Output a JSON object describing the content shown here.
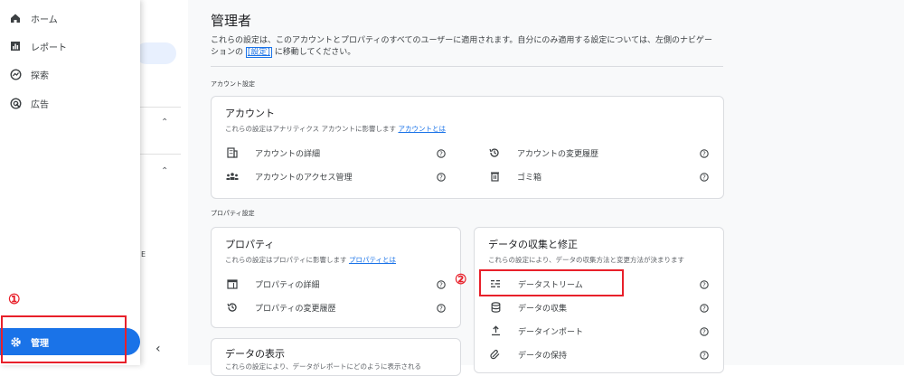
{
  "nav": {
    "items": [
      {
        "label": "ホーム",
        "icon": "home-icon"
      },
      {
        "label": "レポート",
        "icon": "reports-icon"
      },
      {
        "label": "探索",
        "icon": "explore-icon"
      },
      {
        "label": "広告",
        "icon": "advertising-icon"
      }
    ],
    "admin_label": "管理"
  },
  "page": {
    "title": "管理者",
    "desc_line1": "これらの設定は、このアカウントとプロパティのすべてのユーザーに適用されます。自分にのみ適用する設定については、左側のナビゲー",
    "desc_line2_pre": "ションの",
    "desc_link": "[設定]",
    "desc_line2_post": "に移動してください。",
    "account_section": "アカウント設定",
    "property_section": "プロパティ設定"
  },
  "account_card": {
    "title": "アカウント",
    "sub": "これらの設定はアナリティクス アカウントに影響します",
    "sub_link": "アカウントとは",
    "rows": [
      "アカウントの詳細",
      "アカウントのアクセス管理",
      "アカウントの変更履歴",
      "ゴミ箱"
    ]
  },
  "property_card": {
    "title": "プロパティ",
    "sub": "これらの設定はプロパティに影響します",
    "sub_link": "プロパティとは",
    "rows": [
      "プロパティの詳細",
      "プロパティの変更履歴"
    ]
  },
  "data_card": {
    "title": "データの収集と修正",
    "sub": "これらの設定により、データの収集方法と変更方法が決まります",
    "rows": [
      "データストリーム",
      "データの収集",
      "データインポート",
      "データの保持"
    ]
  },
  "display_card": {
    "title": "データの表示",
    "sub": "これらの設定により、データがレポートにどのように表示される"
  },
  "annotations": {
    "one": "①",
    "two": "②"
  },
  "colors": {
    "accent": "#1a73e8",
    "highlight": "#e8202a",
    "active_pill": "#e8f0fe"
  }
}
